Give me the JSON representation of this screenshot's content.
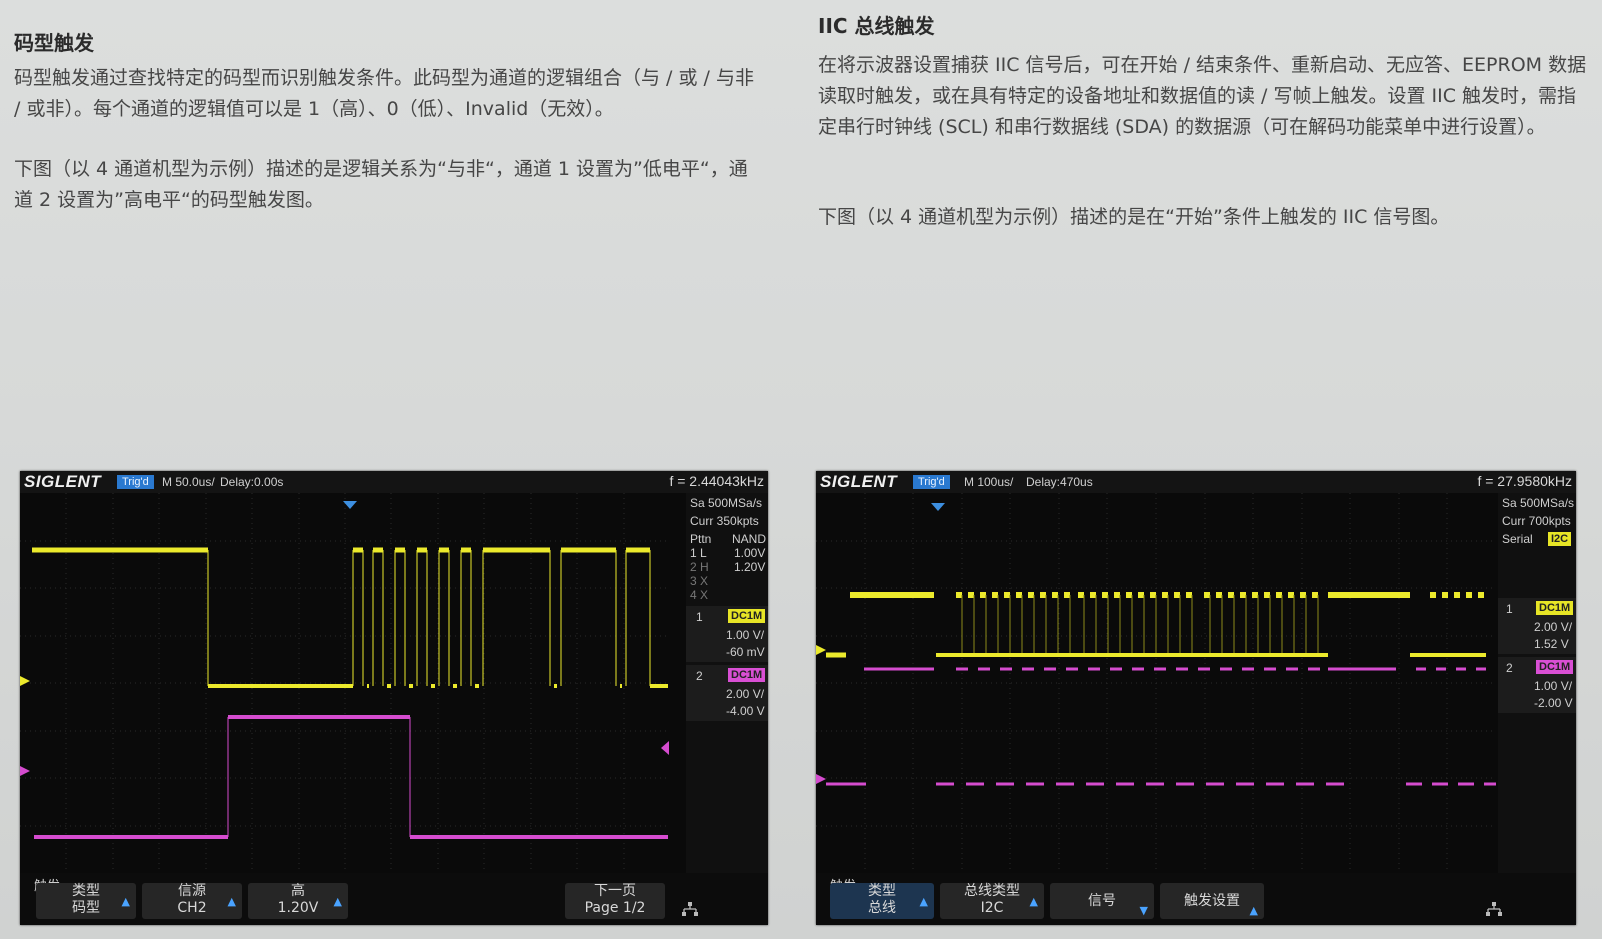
{
  "left": {
    "heading": "码型触发",
    "p1": "码型触发通过查找特定的码型而识别触发条件。此码型为通道的逻辑组合（与 / 或 / 与非 / 或非）。每个通道的逻辑值可以是 1（高）、0（低）、Invalid（无效）。",
    "p2": "下图（以 4 通道机型为示例）描述的是逻辑关系为“与非“，通道 1 设置为”低电平“，通道 2 设置为”高电平“的码型触发图。",
    "scope": {
      "brand": "SIGLENT",
      "trig": "Trig'd",
      "timebase": "M 50.0us/",
      "delay": "Delay:0.00s",
      "freq": "f = 2.44043kHz",
      "sample_rate": "Sa 500MSa/s",
      "curr": "Curr 350kpts",
      "pttn_label": "Pttn",
      "pttn_logic": "NAND",
      "pattern": [
        {
          "ch": "1 L",
          "val": "1.00V"
        },
        {
          "ch": "2 H",
          "val": "1.20V"
        },
        {
          "ch": "3 X",
          "val": ""
        },
        {
          "ch": "4 X",
          "val": ""
        }
      ],
      "ch1": {
        "num": "1",
        "coupling": "DC1M",
        "scale": "1.00 V/",
        "offset": "-60 mV"
      },
      "ch2": {
        "num": "2",
        "coupling": "DC1M",
        "scale": "2.00 V/",
        "offset": "-4.00 V"
      },
      "menu_title": "触发",
      "softkeys": [
        {
          "top": "类型",
          "bottom": "码型"
        },
        {
          "top": "信源",
          "bottom": "CH2"
        },
        {
          "top": "高",
          "bottom": "1.20V"
        },
        {
          "top": "下一页",
          "bottom": "Page 1/2"
        }
      ]
    }
  },
  "right": {
    "heading": "IIC 总线触发",
    "p1": "在将示波器设置捕获 IIC 信号后，可在开始 / 结束条件、重新启动、无应答、EEPROM 数据读取时触发，或在具有特定的设备地址和数据值的读 / 写帧上触发。设置 IIC 触发时，需指定串行时钟线 (SCL) 和串行数据线 (SDA) 的数据源（可在解码功能菜单中进行设置）。",
    "p2": "下图（以 4 通道机型为示例）描述的是在“开始”条件上触发的 IIC 信号图。",
    "scope": {
      "brand": "SIGLENT",
      "trig": "Trig'd",
      "timebase": "M 100us/",
      "delay": "Delay:470us",
      "freq": "f = 27.9580kHz",
      "sample_rate": "Sa 500MSa/s",
      "curr": "Curr 700kpts",
      "serial_label": "Serial",
      "serial_value": "I2C",
      "ch1": {
        "num": "1",
        "coupling": "DC1M",
        "scale": "2.00 V/",
        "offset": "1.52 V"
      },
      "ch2": {
        "num": "2",
        "coupling": "DC1M",
        "scale": "1.00 V/",
        "offset": "-2.00 V"
      },
      "menu_title": "触发",
      "softkeys": [
        {
          "top": "类型",
          "bottom": "总线"
        },
        {
          "top": "总线类型",
          "bottom": "I2C"
        },
        {
          "top": "信号",
          "bottom": ""
        },
        {
          "top": "触发设置",
          "bottom": ""
        }
      ]
    }
  },
  "colors": {
    "ch1": "#ecea2c",
    "ch2": "#d54ccf",
    "accent": "#2a79d0"
  }
}
